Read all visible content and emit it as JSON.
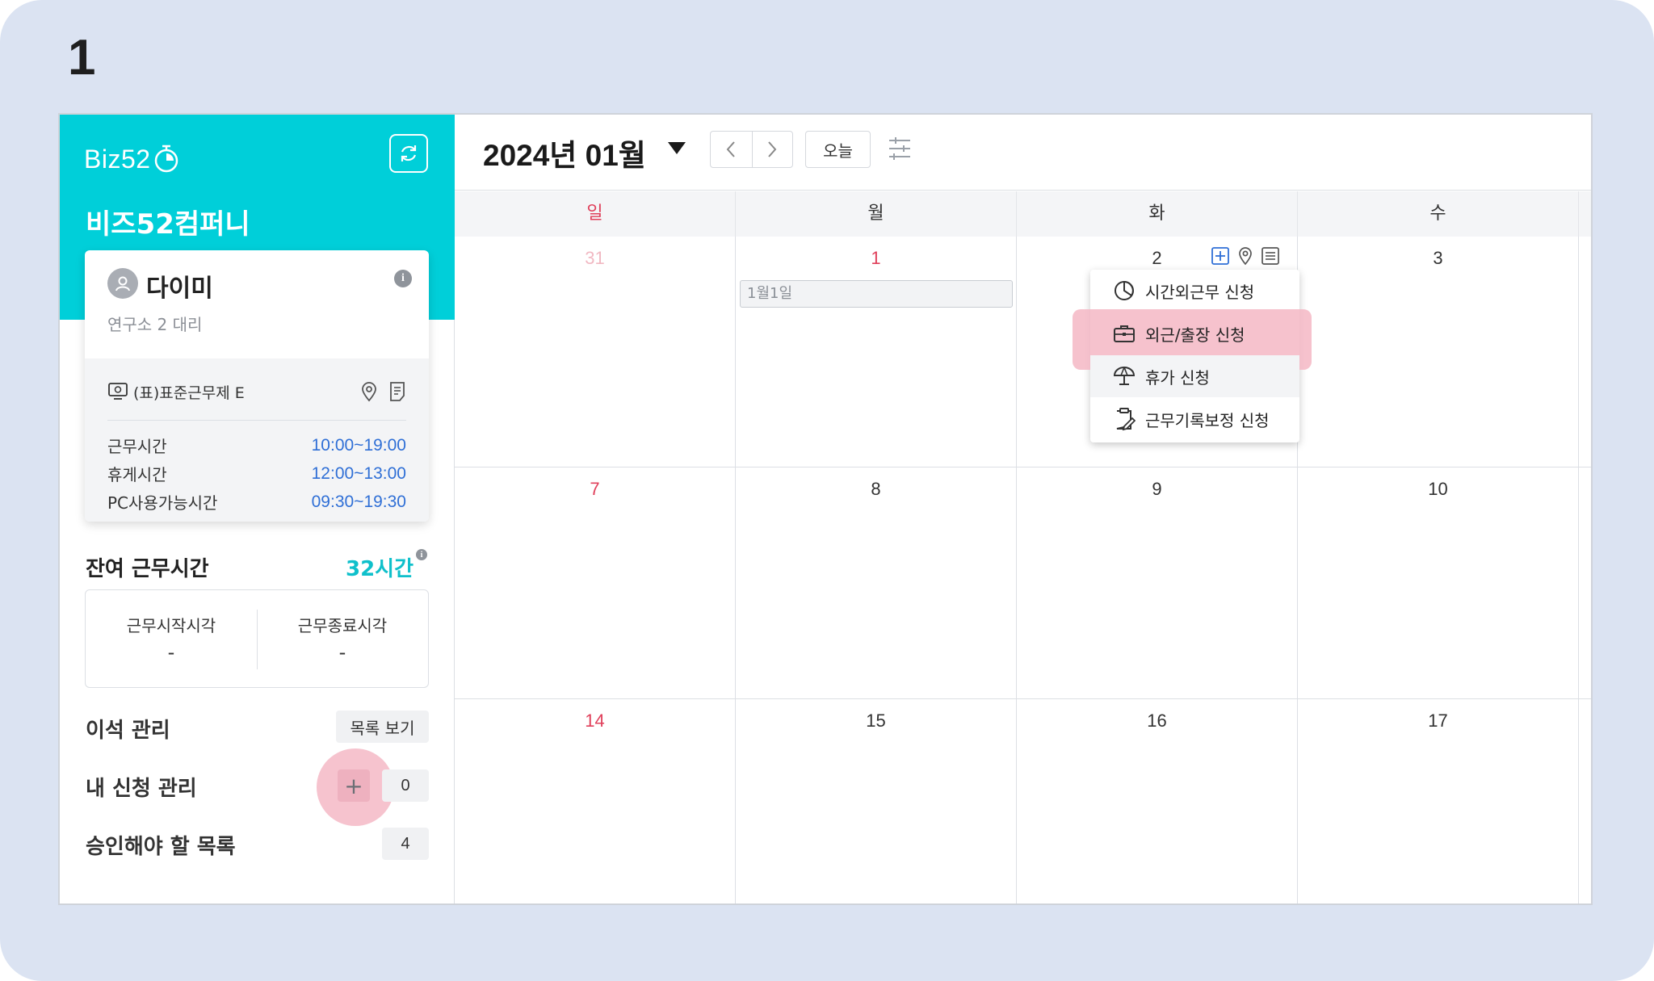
{
  "step_number": "1",
  "sidebar": {
    "logo_text": "Biz52",
    "company": "비즈52컴퍼니",
    "user": {
      "name": "다이미",
      "dept": "연구소 2 대리"
    },
    "schedule": {
      "name": "(표)표준근무제 E",
      "rows": [
        {
          "label": "근무시간",
          "value": "10:00~19:00"
        },
        {
          "label": "휴게시간",
          "value": "12:00~13:00"
        },
        {
          "label": "PC사용가능시간",
          "value": "09:30~19:30"
        }
      ]
    },
    "remaining": {
      "label": "잔여 근무시간",
      "value": "32시간"
    },
    "worktime": {
      "start_label": "근무시작시각",
      "start_value": "-",
      "end_label": "근무종료시각",
      "end_value": "-"
    },
    "away": {
      "label": "이석 관리",
      "button": "목록 보기"
    },
    "my_requests": {
      "label": "내 신청 관리",
      "plus": "+",
      "count": "0"
    },
    "approvals": {
      "label": "승인해야 할 목록",
      "count": "4"
    }
  },
  "calendar": {
    "month_title": "2024년 01월",
    "today_button": "오늘",
    "weekdays": [
      "일",
      "월",
      "화",
      "수"
    ],
    "weeks": [
      [
        "31",
        "1",
        "2",
        "3"
      ],
      [
        "7",
        "8",
        "9",
        "10"
      ],
      [
        "14",
        "15",
        "16",
        "17"
      ]
    ],
    "holiday_label": "1월1일",
    "popup_items": [
      {
        "label": "시간외근무 신청",
        "icon": "clock-pie-icon"
      },
      {
        "label": "외근/출장 신청",
        "icon": "briefcase-icon"
      },
      {
        "label": "휴가 신청",
        "icon": "umbrella-icon"
      },
      {
        "label": "근무기록보정 신청",
        "icon": "clipboard-edit-icon"
      }
    ]
  },
  "colors": {
    "brand_teal": "#00cfd9",
    "sunday_red": "#e0405b",
    "time_blue": "#2f6fd6",
    "highlight_pink": "#f5b7c4"
  }
}
